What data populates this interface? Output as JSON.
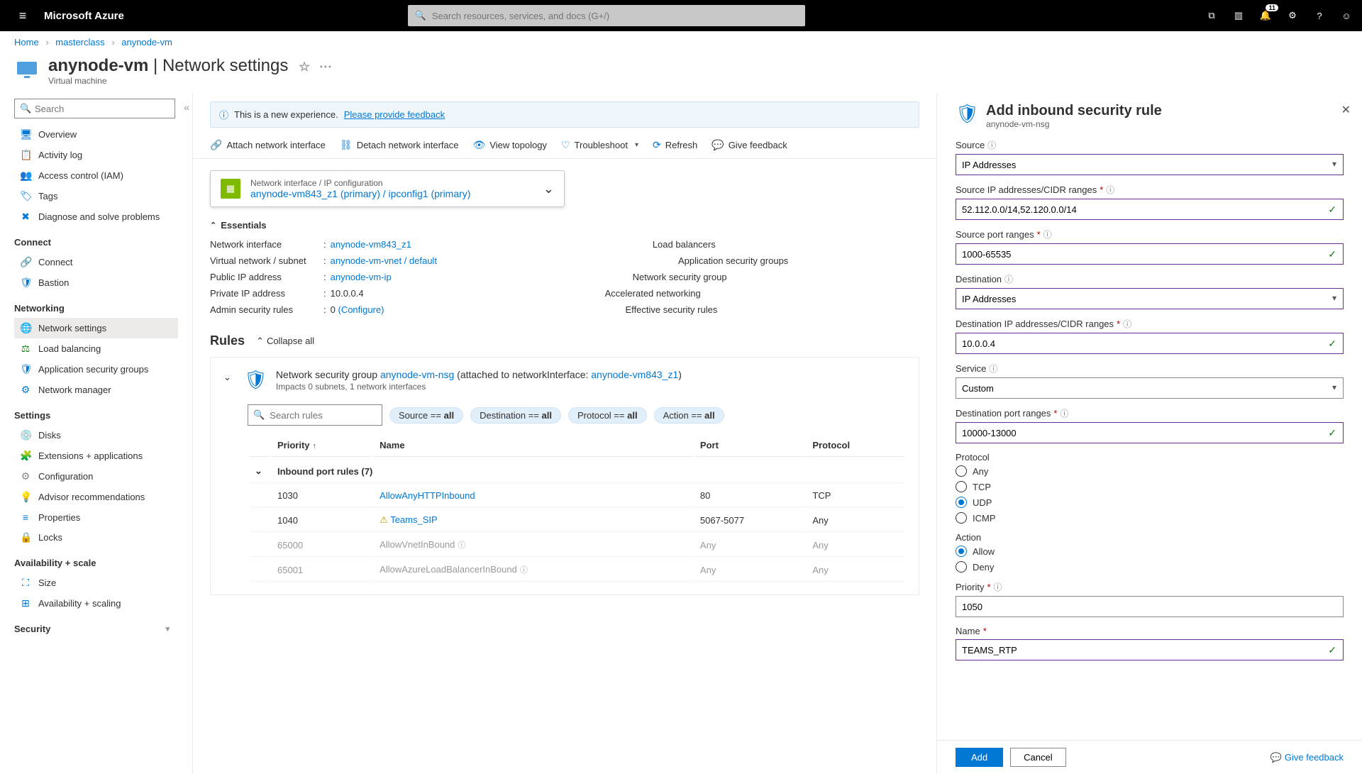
{
  "topbar": {
    "brand": "Microsoft Azure",
    "search_placeholder": "Search resources, services, and docs (G+/)",
    "notif_count": "11"
  },
  "breadcrumb": {
    "home": "Home",
    "group": "masterclass",
    "vm": "anynode-vm"
  },
  "page": {
    "title_vm": "anynode-vm",
    "title_section": "Network settings",
    "subtitle": "Virtual machine",
    "search_placeholder": "Search"
  },
  "sidebar": {
    "overview": "Overview",
    "activity": "Activity log",
    "iam": "Access control (IAM)",
    "tags": "Tags",
    "diag": "Diagnose and solve problems",
    "grp_connect": "Connect",
    "connect": "Connect",
    "bastion": "Bastion",
    "grp_networking": "Networking",
    "netset": "Network settings",
    "lb": "Load balancing",
    "asg": "Application security groups",
    "netmgr": "Network manager",
    "grp_settings": "Settings",
    "disks": "Disks",
    "ext": "Extensions + applications",
    "config": "Configuration",
    "advisor": "Advisor recommendations",
    "props": "Properties",
    "locks": "Locks",
    "grp_avail": "Availability + scale",
    "size": "Size",
    "avail": "Availability + scaling",
    "grp_security": "Security"
  },
  "banner": {
    "text": "This is a new experience.",
    "link": "Please provide feedback"
  },
  "toolbar": {
    "attach": "Attach network interface",
    "detach": "Detach network interface",
    "topology": "View topology",
    "troubleshoot": "Troubleshoot",
    "refresh": "Refresh",
    "feedback": "Give feedback"
  },
  "nic": {
    "small": "Network interface / IP configuration",
    "line": "anynode-vm843_z1 (primary) / ipconfig1 (primary)"
  },
  "essentials": {
    "head": "Essentials",
    "nic_label": "Network interface",
    "nic_val": "anynode-vm843_z1",
    "vnet_label": "Virtual network / subnet",
    "vnet_val": "anynode-vm-vnet / default",
    "pip_label": "Public IP address",
    "pip_val": "anynode-vm-ip",
    "prip_label": "Private IP address",
    "prip_val": "10.0.0.4",
    "admin_label": "Admin security rules",
    "admin_val": "0",
    "admin_link": "(Configure)",
    "lb_label": "Load balancers",
    "asg_label": "Application security groups",
    "nsg_label": "Network security group",
    "accel_label": "Accelerated networking",
    "eff_label": "Effective security rules"
  },
  "rules": {
    "head": "Rules",
    "collapse": "Collapse all",
    "nsg_prefix": "Network security group",
    "nsg_link": "anynode-vm-nsg",
    "nsg_attach": "(attached to networkInterface:",
    "nsg_nic": "anynode-vm843_z1",
    "nsg_close": ")",
    "nsg_sub": "Impacts 0 subnets, 1 network interfaces",
    "search_placeholder": "Search rules",
    "f_source": "Source == ",
    "f_dest": "Destination == ",
    "f_proto": "Protocol == ",
    "f_action": "Action == ",
    "f_all": "all",
    "th_priority": "Priority",
    "th_name": "Name",
    "th_port": "Port",
    "th_protocol": "Protocol",
    "group_label": "Inbound port rules (7)",
    "rows": [
      {
        "priority": "1030",
        "name": "AllowAnyHTTPInbound",
        "port": "80",
        "protocol": "TCP",
        "warn": false,
        "default": false
      },
      {
        "priority": "1040",
        "name": "Teams_SIP",
        "port": "5067-5077",
        "protocol": "Any",
        "warn": true,
        "default": false
      },
      {
        "priority": "65000",
        "name": "AllowVnetInBound",
        "port": "Any",
        "protocol": "Any",
        "warn": false,
        "default": true
      },
      {
        "priority": "65001",
        "name": "AllowAzureLoadBalancerInBound",
        "port": "Any",
        "protocol": "Any",
        "warn": false,
        "default": true
      }
    ]
  },
  "panel": {
    "title": "Add inbound security rule",
    "subtitle": "anynode-vm-nsg",
    "lbl_source": "Source",
    "val_source": "IP Addresses",
    "lbl_src_ip": "Source IP addresses/CIDR ranges",
    "val_src_ip": "52.112.0.0/14,52.120.0.0/14",
    "lbl_src_port": "Source port ranges",
    "val_src_port": "1000-65535",
    "lbl_dest": "Destination",
    "val_dest": "IP Addresses",
    "lbl_dest_ip": "Destination IP addresses/CIDR ranges",
    "val_dest_ip": "10.0.0.4",
    "lbl_service": "Service",
    "val_service": "Custom",
    "lbl_dest_port": "Destination port ranges",
    "val_dest_port": "10000-13000",
    "lbl_protocol": "Protocol",
    "proto_any": "Any",
    "proto_tcp": "TCP",
    "proto_udp": "UDP",
    "proto_icmp": "ICMP",
    "lbl_action": "Action",
    "action_allow": "Allow",
    "action_deny": "Deny",
    "lbl_priority": "Priority",
    "val_priority": "1050",
    "lbl_name": "Name",
    "val_name": "TEAMS_RTP",
    "btn_add": "Add",
    "btn_cancel": "Cancel",
    "feedback": "Give feedback"
  }
}
